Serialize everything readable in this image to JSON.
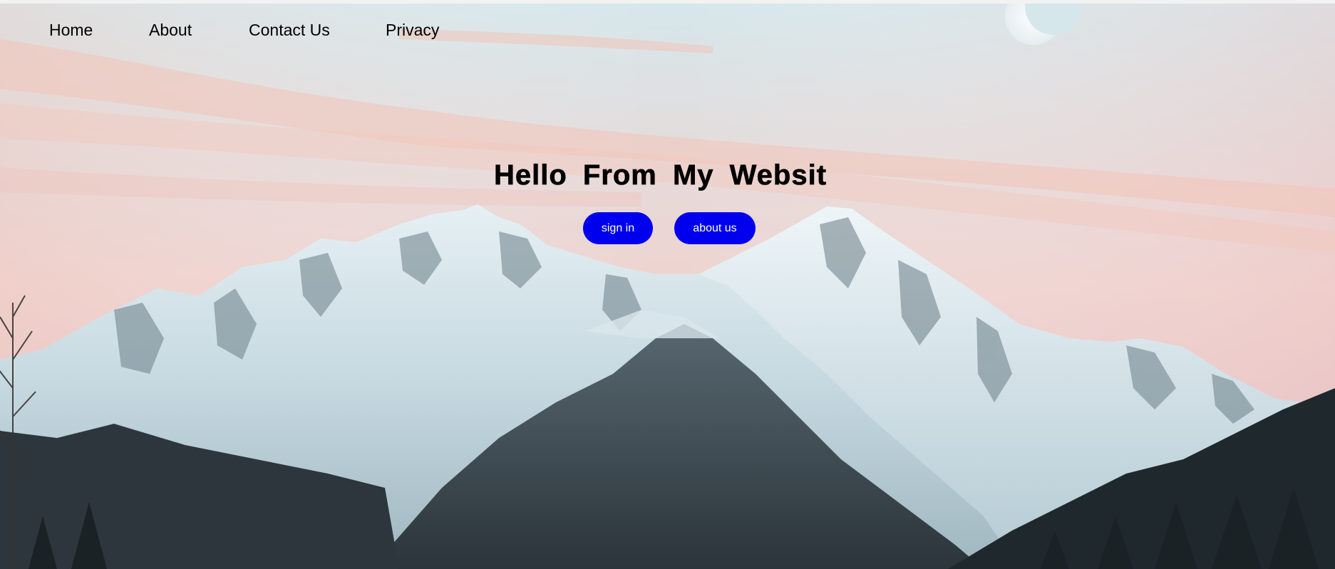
{
  "nav": {
    "items": [
      {
        "label": "Home"
      },
      {
        "label": "About"
      },
      {
        "label": "Contact Us"
      },
      {
        "label": "Privacy"
      }
    ]
  },
  "hero": {
    "title": "Hello From My Websit",
    "buttons": {
      "sign_in": "sign in",
      "about_us": "about us"
    },
    "button_color": "#0000ee",
    "button_text_color": "#ffffff"
  },
  "background": {
    "description_icon": "snowy-mountains-image",
    "sky_colors": [
      "#d8e6ea",
      "#f3cfc6",
      "#e8d9dc"
    ],
    "moon_icon": "moon-icon"
  }
}
